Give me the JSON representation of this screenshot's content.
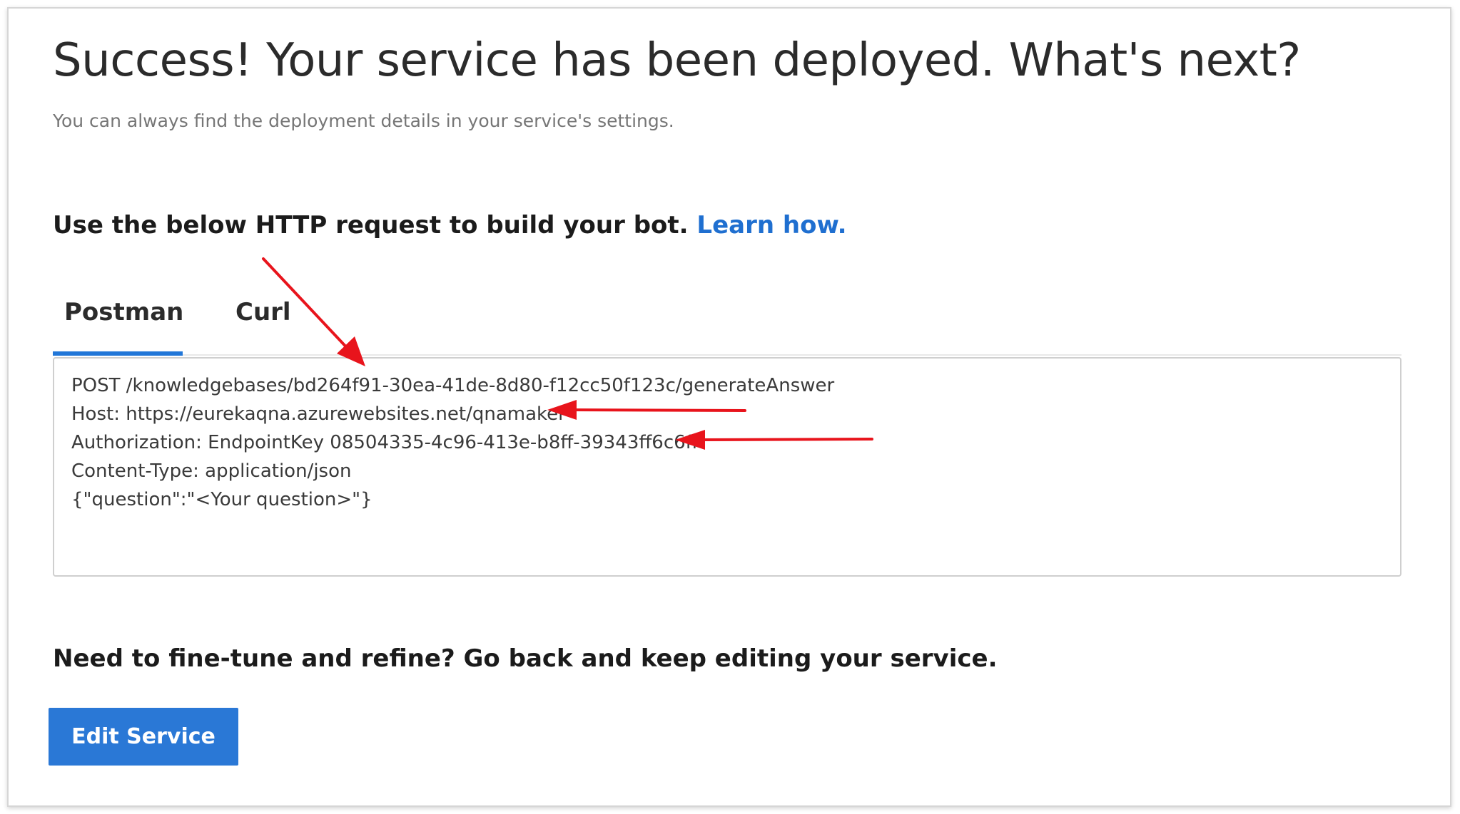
{
  "header": {
    "title": "Success! Your service has been deployed. What's next?",
    "subtitle": "You can always find the deployment details in your service's settings."
  },
  "http_section": {
    "heading": "Use the below HTTP request to build your bot.",
    "link_label": "Learn how."
  },
  "tabs": [
    {
      "label": "Postman",
      "selected": true
    },
    {
      "label": "Curl",
      "selected": false
    }
  ],
  "request_lines": [
    "POST /knowledgebases/bd264f91-30ea-41de-8d80-f12cc50f123c/generateAnswer",
    "Host: https://eurekaqna.azurewebsites.net/qnamaker",
    "Authorization: EndpointKey 08504335-4c96-413e-b8ff-39343ff6c6ff",
    "Content-Type: application/json",
    "{\"question\":\"<Your question>\"}"
  ],
  "edit_section": {
    "heading": "Need to fine-tune and refine? Go back and keep editing your service.",
    "button_label": "Edit Service"
  },
  "colors": {
    "accent": "#2a78d6",
    "link": "#1f6fd0",
    "annotation_arrow": "#e8141c"
  },
  "annotations": [
    "arrow-icon",
    "arrow-icon",
    "arrow-icon"
  ]
}
